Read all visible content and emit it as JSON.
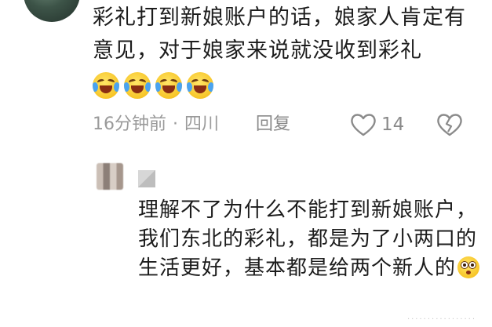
{
  "comment": {
    "text": "彩礼打到新娘账户的话，娘家人肯定有意见，对于娘家来说就没收到彩礼",
    "time": "16分钟前",
    "separator": "·",
    "location": "四川",
    "reply_label": "回复",
    "like_count": "14"
  },
  "reply": {
    "text": "理解不了为什么不能打到新娘账户，我们东北的彩礼，都是为了小两口的生活更好，基本都是给两个新人的"
  },
  "watermark": "·················"
}
